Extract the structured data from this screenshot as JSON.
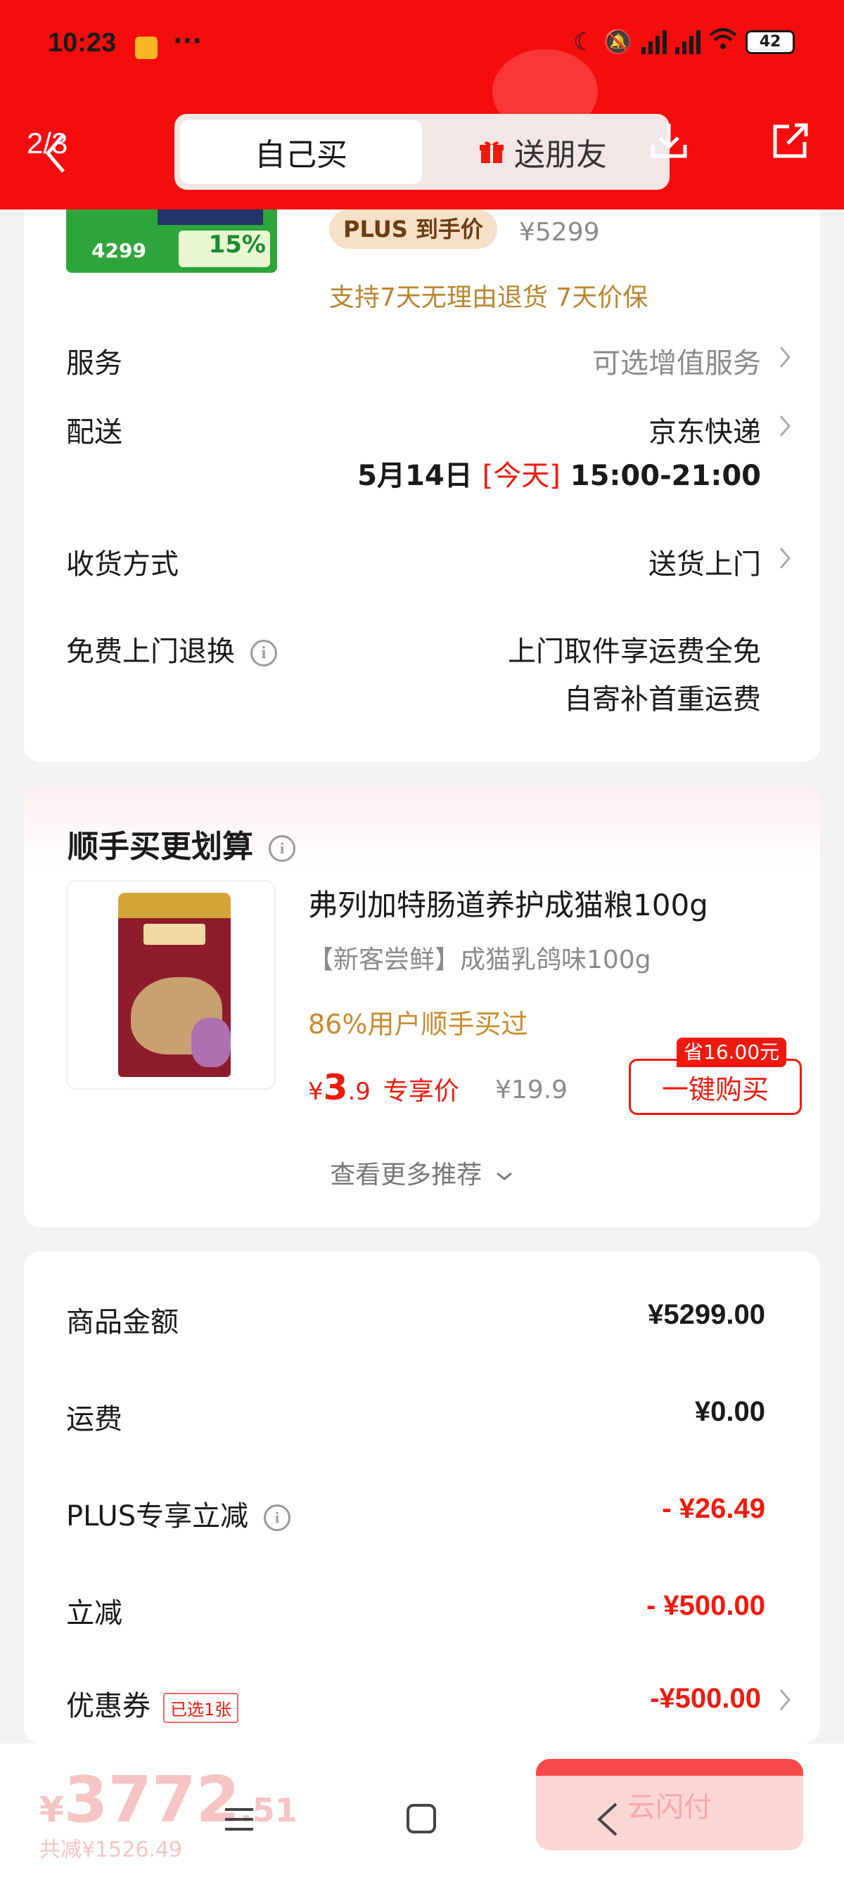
{
  "status_bar": {
    "time": "10:23",
    "more": "···",
    "battery": "42"
  },
  "header": {
    "page_indicator": "2/3",
    "tabs": [
      {
        "label": "自己买",
        "active": true
      },
      {
        "label": "送朋友",
        "active": false
      }
    ]
  },
  "product": {
    "thumb_price": "4299",
    "thumb_badge": "15%",
    "plus_tag": "PLUS 到手价",
    "original_price": "¥5299",
    "guarantee": "支持7天无理由退货  7天价保"
  },
  "order_info": {
    "service_label": "服务",
    "service_value": "可选增值服务",
    "delivery_label": "配送",
    "delivery_value": "京东快递",
    "delivery_date": "5月14日",
    "delivery_today": "[今天]",
    "delivery_time": "15:00-21:00",
    "receive_label": "收货方式",
    "receive_value": "送货上门",
    "return_label": "免费上门退换",
    "return_value_1": "上门取件享运费全免",
    "return_value_2": "自寄补首重运费"
  },
  "recommend": {
    "title": "顺手买更划算",
    "name": "弗列加特肠道养护成猫粮100g",
    "spec": "【新客尝鲜】成猫乳鸽味100g",
    "stat": "86%用户顺手买过",
    "currency": "¥",
    "price_int": "3",
    "price_dec": ".9",
    "price_tag": "专享价",
    "original_price": "¥19.9",
    "save_badge": "省16.00元",
    "buy_button": "一键购买",
    "more_link": "查看更多推荐"
  },
  "summary": {
    "rows": [
      {
        "label": "商品金额",
        "value": "¥5299.00"
      },
      {
        "label": "运费",
        "value": "¥0.00"
      },
      {
        "label": "PLUS专享立减",
        "value": "- ¥26.49"
      },
      {
        "label": "立减",
        "value": "- ¥500.00"
      },
      {
        "label": "优惠券",
        "value": "-¥500.00",
        "tag": "已选1张"
      }
    ]
  },
  "bottom_bar": {
    "currency": "¥",
    "total_int": "3772",
    "total_dec": ".51",
    "discount": "共减¥1526.49",
    "pay_button": "云闪付"
  },
  "colors": {
    "header_red": "#f50d0d",
    "price_red": "#f0190d",
    "gold": "#b8862f"
  }
}
